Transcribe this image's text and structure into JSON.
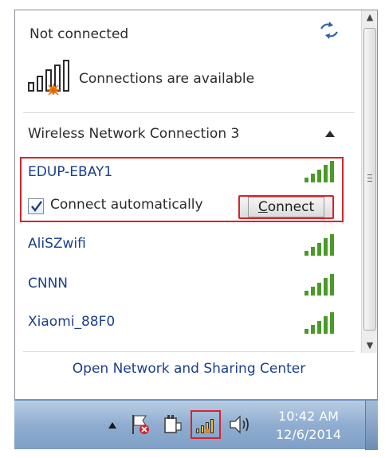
{
  "flyout": {
    "status": "Not connected",
    "available": "Connections are available",
    "section_title": "Wireless Network Connection 3",
    "footer_link": "Open Network and Sharing Center"
  },
  "selected_network": {
    "name": "EDUP-EBAY1",
    "auto_connect_label": "Connect automatically",
    "auto_connect_checked": true,
    "connect_button": {
      "accelerator": "C",
      "rest": "onnect"
    }
  },
  "networks": [
    {
      "name": "AliSZwifi"
    },
    {
      "name": "CNNN"
    },
    {
      "name": "Xiaomi_88F0"
    }
  ],
  "taskbar": {
    "time": "10:42 AM",
    "date": "12/6/2014"
  },
  "colors": {
    "highlight": "#d8232a",
    "link": "#1a3f8a",
    "signal": "#4a9a2a"
  },
  "icons": [
    "refresh-icon",
    "connections-available-icon",
    "collapse-icon",
    "signal-strength-icon",
    "checkmark-icon",
    "action-center-flag-icon",
    "power-icon",
    "network-tray-icon",
    "speaker-icon"
  ]
}
